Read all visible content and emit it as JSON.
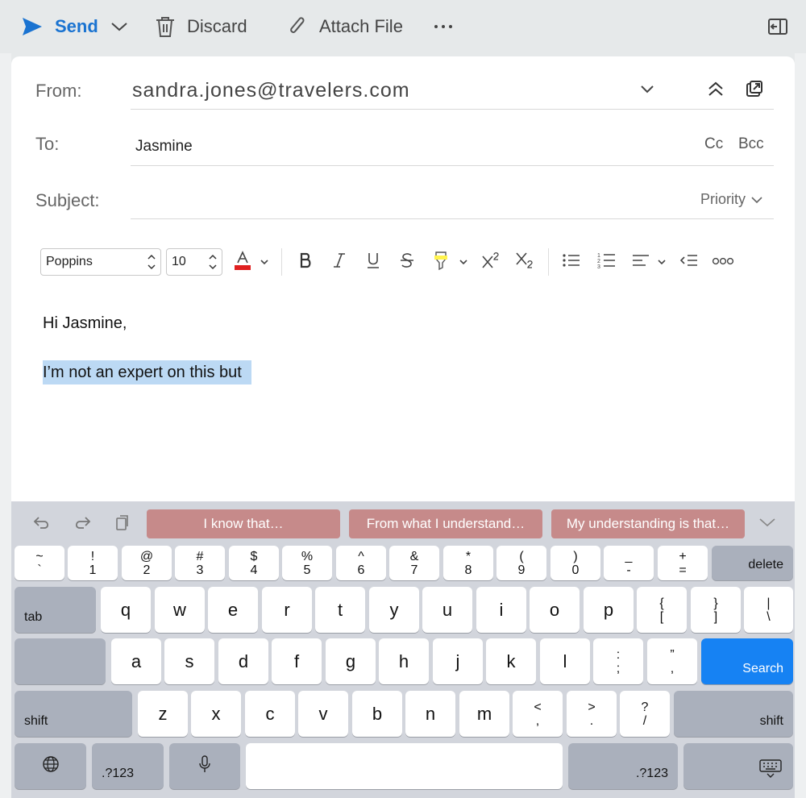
{
  "toolbar": {
    "send": "Send",
    "discard": "Discard",
    "attach": "Attach File"
  },
  "compose": {
    "from_label": "From:",
    "from_value": "sandra.jones@travelers.com",
    "to_label": "To:",
    "to_value": "Jasmine",
    "cc": "Cc",
    "bcc": "Bcc",
    "subject_label": "Subject:",
    "subject_value": "",
    "priority": "Priority"
  },
  "format": {
    "font": "Poppins",
    "size": "10",
    "text_color": "#e02020",
    "highlight_color": "#fff34d"
  },
  "body": {
    "line1": "Hi Jasmine,",
    "line2": "I’m not an expert on this but"
  },
  "keyboard": {
    "suggestions": [
      "I know that…",
      "From what I understand…",
      "My understanding is that…"
    ],
    "number_row": [
      {
        "top": "~",
        "bottom": "`"
      },
      {
        "top": "!",
        "bottom": "1"
      },
      {
        "top": "@",
        "bottom": "2"
      },
      {
        "top": "#",
        "bottom": "3"
      },
      {
        "top": "$",
        "bottom": "4"
      },
      {
        "top": "%",
        "bottom": "5"
      },
      {
        "top": "^",
        "bottom": "6"
      },
      {
        "top": "&",
        "bottom": "7"
      },
      {
        "top": "*",
        "bottom": "8"
      },
      {
        "top": "(",
        "bottom": "9"
      },
      {
        "top": ")",
        "bottom": "0"
      },
      {
        "top": "_",
        "bottom": "-"
      },
      {
        "top": "+",
        "bottom": "="
      }
    ],
    "delete": "delete",
    "tab": "tab",
    "row_q": [
      "q",
      "w",
      "e",
      "r",
      "t",
      "y",
      "u",
      "i",
      "o",
      "p"
    ],
    "row_q_symbols": [
      {
        "top": "{",
        "bottom": "["
      },
      {
        "top": "}",
        "bottom": "]"
      },
      {
        "top": "|",
        "bottom": "\\"
      }
    ],
    "row_a": [
      "a",
      "s",
      "d",
      "f",
      "g",
      "h",
      "j",
      "k",
      "l"
    ],
    "row_a_symbols": [
      {
        "top": ":",
        "bottom": ";"
      },
      {
        "top": "”",
        "bottom": ","
      }
    ],
    "search": "Search",
    "shift": "shift",
    "row_z": [
      "z",
      "x",
      "c",
      "v",
      "b",
      "n",
      "m"
    ],
    "row_z_symbols": [
      {
        "top": "<",
        "bottom": ","
      },
      {
        "top": ">",
        "bottom": "."
      },
      {
        "top": "?",
        "bottom": "/"
      }
    ],
    "numbers_key": ".?123"
  }
}
